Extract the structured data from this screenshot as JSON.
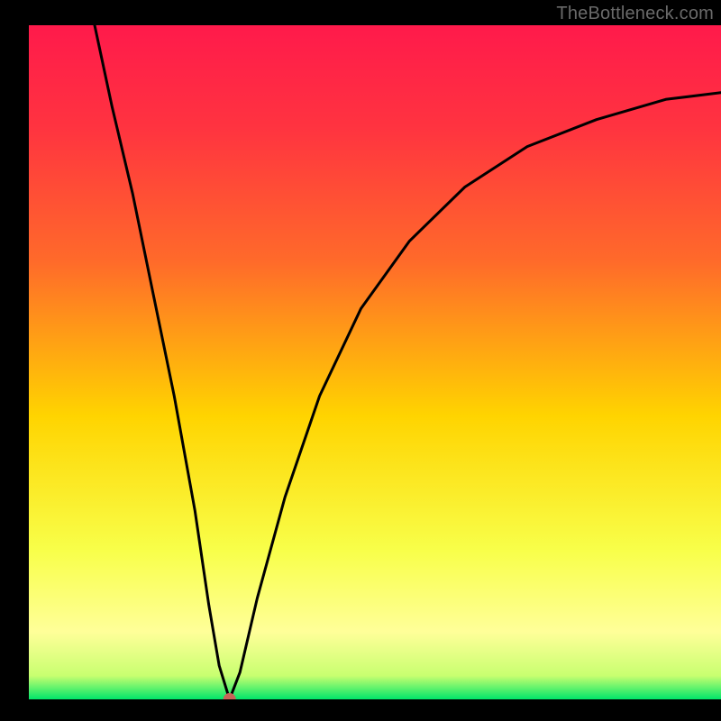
{
  "watermark": "TheBottleneck.com",
  "colors": {
    "gradient_top": "#ff1a4b",
    "gradient_upper_mid": "#ff6a2a",
    "gradient_mid": "#ffd400",
    "gradient_lower_mid": "#f8ff4a",
    "gradient_band": "#ffff99",
    "gradient_bottom": "#00e66a",
    "curve": "#000000",
    "marker": "#c86458",
    "frame": "#000000"
  },
  "chart_data": {
    "type": "line",
    "title": "",
    "xlabel": "",
    "ylabel": "",
    "xlim": [
      0,
      100
    ],
    "ylim": [
      0,
      100
    ],
    "marker": {
      "x": 29,
      "y": 0
    },
    "series": [
      {
        "name": "bottleneck-curve",
        "points": [
          {
            "x": 9.5,
            "y": 100
          },
          {
            "x": 12,
            "y": 88
          },
          {
            "x": 15,
            "y": 75
          },
          {
            "x": 18,
            "y": 60
          },
          {
            "x": 21,
            "y": 45
          },
          {
            "x": 24,
            "y": 28
          },
          {
            "x": 26,
            "y": 14
          },
          {
            "x": 27.5,
            "y": 5
          },
          {
            "x": 29,
            "y": 0
          },
          {
            "x": 30.5,
            "y": 4
          },
          {
            "x": 33,
            "y": 15
          },
          {
            "x": 37,
            "y": 30
          },
          {
            "x": 42,
            "y": 45
          },
          {
            "x": 48,
            "y": 58
          },
          {
            "x": 55,
            "y": 68
          },
          {
            "x": 63,
            "y": 76
          },
          {
            "x": 72,
            "y": 82
          },
          {
            "x": 82,
            "y": 86
          },
          {
            "x": 92,
            "y": 89
          },
          {
            "x": 100,
            "y": 90
          }
        ]
      }
    ]
  }
}
